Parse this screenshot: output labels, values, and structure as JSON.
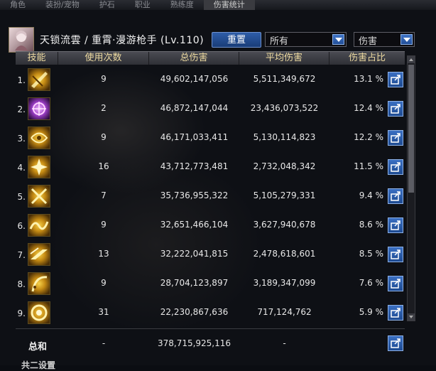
{
  "background_tabs": [
    "角色",
    "装扮/宠物",
    "护石",
    "职业",
    "熟练度",
    "伤害统计"
  ],
  "header": {
    "character": "天锁流雲 / 重霄·漫游枪手 (Lv.110)",
    "reset_label": "重置",
    "filter_1": "所有",
    "filter_2": "伤害"
  },
  "columns": {
    "skill": "技能",
    "uses": "使用次数",
    "total": "总伤害",
    "avg": "平均伤害",
    "pct": "伤害占比"
  },
  "rows": [
    {
      "idx": "1.",
      "uses": "9",
      "total": "49,602,147,056",
      "avg": "5,511,349,672",
      "pct": "13.1 %",
      "icon": "golden-slash-skill-icon"
    },
    {
      "idx": "2.",
      "uses": "2",
      "total": "46,872,147,044",
      "avg": "23,436,073,522",
      "pct": "12.4 %",
      "icon": "purple-burst-skill-icon"
    },
    {
      "idx": "3.",
      "uses": "9",
      "total": "46,171,033,411",
      "avg": "5,130,114,823",
      "pct": "12.2 %",
      "icon": "golden-spin-skill-icon"
    },
    {
      "idx": "4.",
      "uses": "16",
      "total": "43,712,773,481",
      "avg": "2,732,048,342",
      "pct": "11.5 %",
      "icon": "golden-spark-skill-icon"
    },
    {
      "idx": "5.",
      "uses": "7",
      "total": "35,736,955,322",
      "avg": "5,105,279,331",
      "pct": "9.4 %",
      "icon": "golden-cross-skill-icon"
    },
    {
      "idx": "6.",
      "uses": "9",
      "total": "32,651,466,104",
      "avg": "3,627,940,678",
      "pct": "8.6 %",
      "icon": "golden-wave-skill-icon"
    },
    {
      "idx": "7.",
      "uses": "13",
      "total": "32,222,041,815",
      "avg": "2,478,618,601",
      "pct": "8.5 %",
      "icon": "golden-dash-skill-icon"
    },
    {
      "idx": "8.",
      "uses": "9",
      "total": "28,704,123,897",
      "avg": "3,189,347,099",
      "pct": "7.6 %",
      "icon": "golden-chain-skill-icon"
    },
    {
      "idx": "9.",
      "uses": "31",
      "total": "22,230,867,636",
      "avg": "717,124,762",
      "pct": "5.9 %",
      "icon": "golden-orb-skill-icon"
    }
  ],
  "total_row": {
    "label": "总和",
    "uses": "-",
    "total": "378,715,925,116",
    "avg": "-"
  },
  "footer_partial": "共二设置"
}
